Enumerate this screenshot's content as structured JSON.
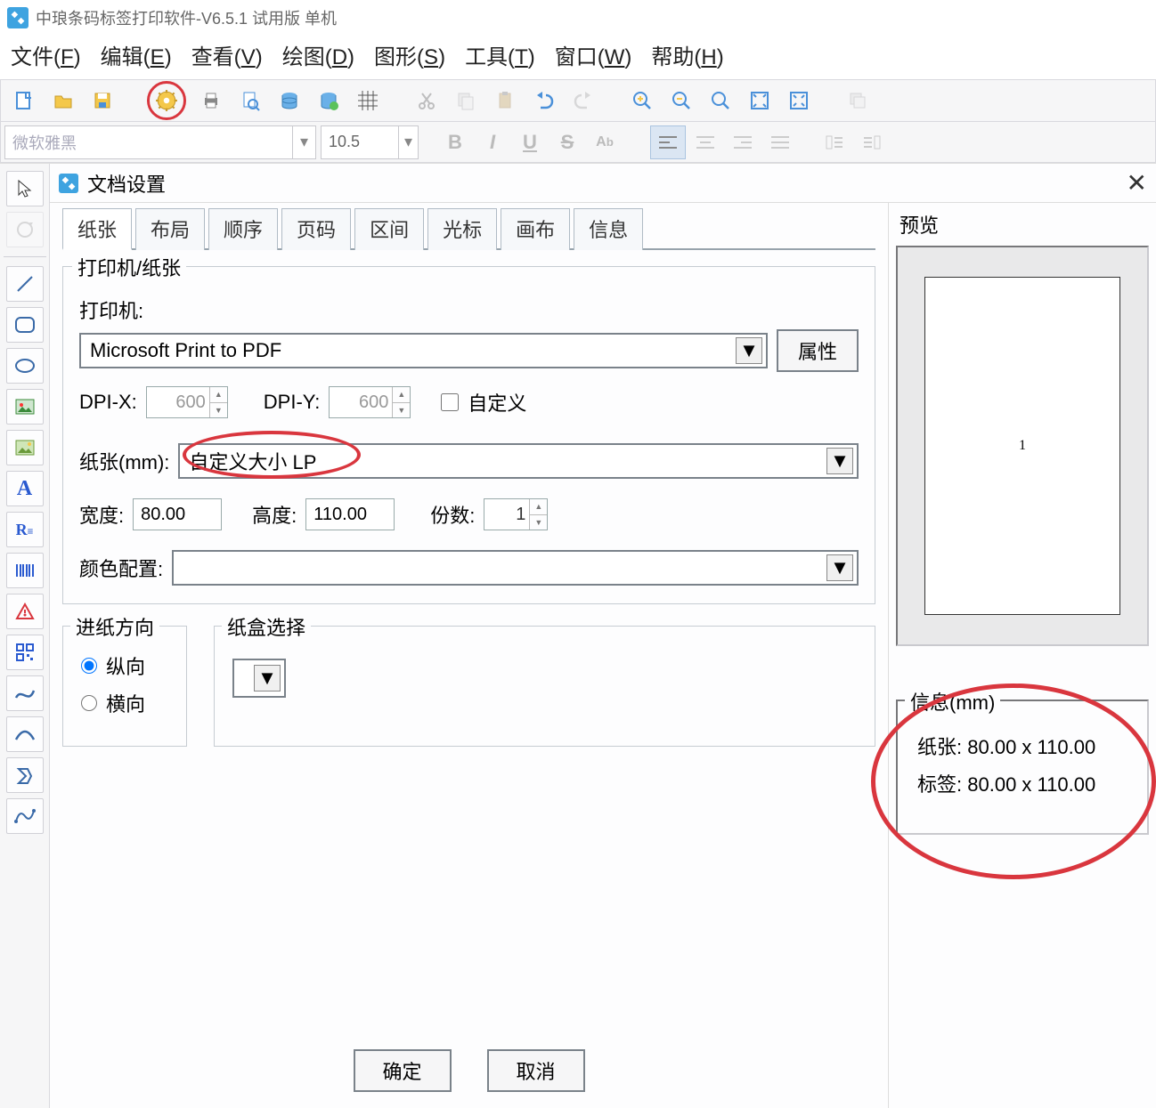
{
  "app": {
    "title": "中琅条码标签打印软件-V6.5.1 试用版 单机"
  },
  "menu": {
    "file": "文件(F)",
    "edit": "编辑(E)",
    "view": "查看(V)",
    "draw": "绘图(D)",
    "shape": "图形(S)",
    "tools": "工具(T)",
    "window": "窗口(W)",
    "help": "帮助(H)"
  },
  "fontbar": {
    "font_placeholder": "微软雅黑",
    "size": "10.5"
  },
  "dialog": {
    "title": "文档设置",
    "tabs": [
      "纸张",
      "布局",
      "顺序",
      "页码",
      "区间",
      "光标",
      "画布",
      "信息"
    ],
    "group_printer_paper": "打印机/纸张",
    "printer_label": "打印机:",
    "printer_value": "Microsoft Print to PDF",
    "prop_btn": "属性",
    "dpix_label": "DPI-X:",
    "dpix_value": "600",
    "dpiy_label": "DPI-Y:",
    "dpiy_value": "600",
    "custom_chk": "自定义",
    "paper_label": "纸张(mm):",
    "paper_value": "自定义大小 LP",
    "width_label": "宽度:",
    "width_value": "80.00",
    "height_label": "高度:",
    "height_value": "110.00",
    "copies_label": "份数:",
    "copies_value": "1",
    "color_label": "颜色配置:",
    "feed_group": "进纸方向",
    "feed_portrait": "纵向",
    "feed_landscape": "横向",
    "tray_group": "纸盒选择",
    "ok_btn": "确定",
    "cancel_btn": "取消"
  },
  "preview": {
    "title": "预览",
    "page_num": "1",
    "info_title": "信息(mm)",
    "paper_line_lbl": "纸张:",
    "paper_line_val": "80.00 x 110.00",
    "label_line_lbl": "标签:",
    "label_line_val": "80.00 x 110.00"
  }
}
